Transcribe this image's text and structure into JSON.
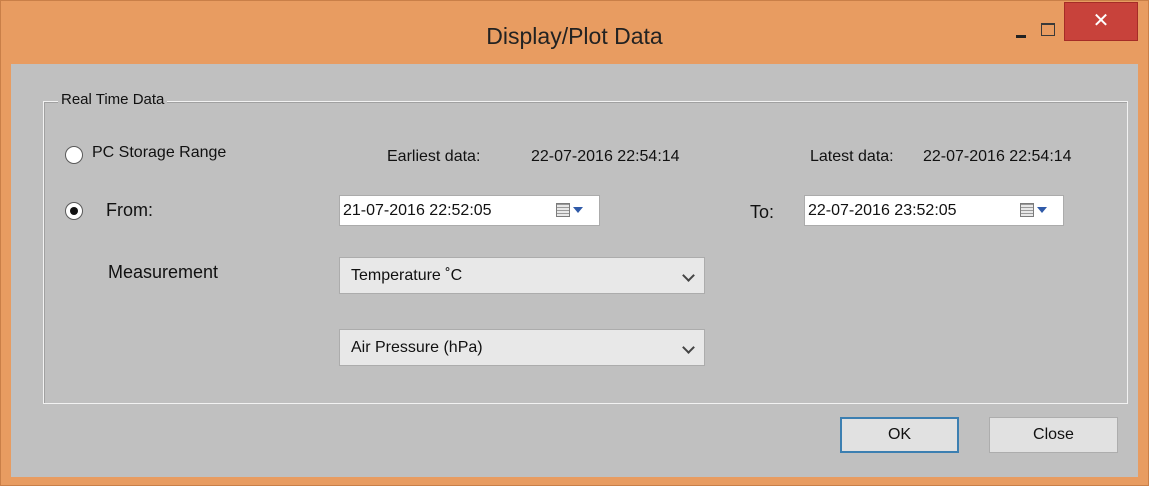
{
  "window": {
    "title": "Display/Plot Data",
    "close_glyph": "✕"
  },
  "group": {
    "label": "Real Time Data"
  },
  "range_options": {
    "pc_storage_label": "PC Storage Range",
    "pc_storage_selected": false,
    "from_label": "From:",
    "from_selected": true
  },
  "info": {
    "earliest_label": "Earliest data:",
    "earliest_value": "22-07-2016 22:54:14",
    "latest_label": "Latest data:",
    "latest_value": "22-07-2016 22:54:14"
  },
  "from_picker": {
    "value": "21-07-2016 22:52:05"
  },
  "to_label": "To:",
  "to_picker": {
    "value": "22-07-2016 23:52:05"
  },
  "measurement": {
    "label": "Measurement",
    "first_selected": "Temperature ˚C",
    "second_selected": "Air Pressure (hPa)"
  },
  "buttons": {
    "ok_label": "OK",
    "close_label": "Close"
  },
  "colors": {
    "title_bar": "#E89C61",
    "client_bg": "#C0C0C0",
    "close_button": "#C8423B",
    "default_button_border": "#3C7FB1"
  },
  "icons": {
    "minimize": "minimize-icon",
    "maximize": "maximize-icon",
    "close": "close-icon",
    "calendar": "calendar-icon",
    "dropdown": "chevron-down-icon"
  }
}
